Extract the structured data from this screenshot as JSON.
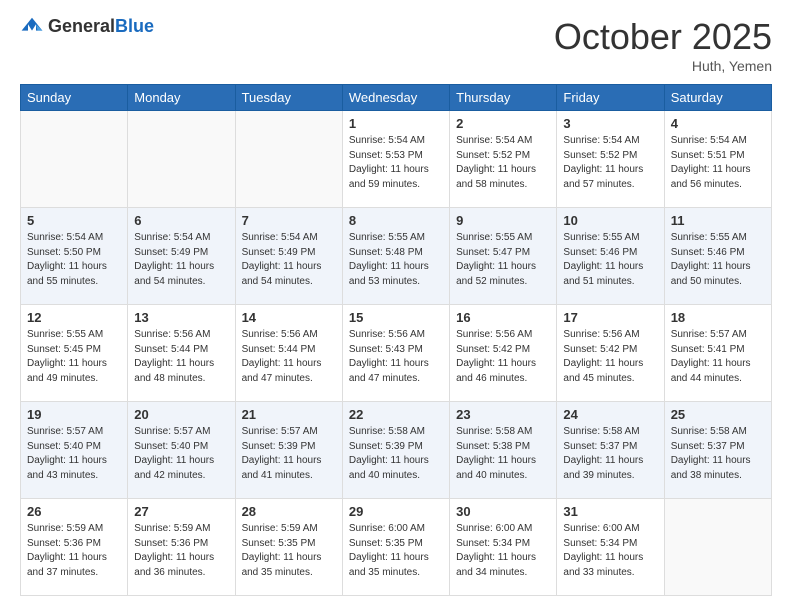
{
  "logo": {
    "text_general": "General",
    "text_blue": "Blue"
  },
  "header": {
    "month": "October 2025",
    "location": "Huth, Yemen"
  },
  "weekdays": [
    "Sunday",
    "Monday",
    "Tuesday",
    "Wednesday",
    "Thursday",
    "Friday",
    "Saturday"
  ],
  "weeks": [
    [
      {
        "day": "",
        "info": ""
      },
      {
        "day": "",
        "info": ""
      },
      {
        "day": "",
        "info": ""
      },
      {
        "day": "1",
        "info": "Sunrise: 5:54 AM\nSunset: 5:53 PM\nDaylight: 11 hours\nand 59 minutes."
      },
      {
        "day": "2",
        "info": "Sunrise: 5:54 AM\nSunset: 5:52 PM\nDaylight: 11 hours\nand 58 minutes."
      },
      {
        "day": "3",
        "info": "Sunrise: 5:54 AM\nSunset: 5:52 PM\nDaylight: 11 hours\nand 57 minutes."
      },
      {
        "day": "4",
        "info": "Sunrise: 5:54 AM\nSunset: 5:51 PM\nDaylight: 11 hours\nand 56 minutes."
      }
    ],
    [
      {
        "day": "5",
        "info": "Sunrise: 5:54 AM\nSunset: 5:50 PM\nDaylight: 11 hours\nand 55 minutes."
      },
      {
        "day": "6",
        "info": "Sunrise: 5:54 AM\nSunset: 5:49 PM\nDaylight: 11 hours\nand 54 minutes."
      },
      {
        "day": "7",
        "info": "Sunrise: 5:54 AM\nSunset: 5:49 PM\nDaylight: 11 hours\nand 54 minutes."
      },
      {
        "day": "8",
        "info": "Sunrise: 5:55 AM\nSunset: 5:48 PM\nDaylight: 11 hours\nand 53 minutes."
      },
      {
        "day": "9",
        "info": "Sunrise: 5:55 AM\nSunset: 5:47 PM\nDaylight: 11 hours\nand 52 minutes."
      },
      {
        "day": "10",
        "info": "Sunrise: 5:55 AM\nSunset: 5:46 PM\nDaylight: 11 hours\nand 51 minutes."
      },
      {
        "day": "11",
        "info": "Sunrise: 5:55 AM\nSunset: 5:46 PM\nDaylight: 11 hours\nand 50 minutes."
      }
    ],
    [
      {
        "day": "12",
        "info": "Sunrise: 5:55 AM\nSunset: 5:45 PM\nDaylight: 11 hours\nand 49 minutes."
      },
      {
        "day": "13",
        "info": "Sunrise: 5:56 AM\nSunset: 5:44 PM\nDaylight: 11 hours\nand 48 minutes."
      },
      {
        "day": "14",
        "info": "Sunrise: 5:56 AM\nSunset: 5:44 PM\nDaylight: 11 hours\nand 47 minutes."
      },
      {
        "day": "15",
        "info": "Sunrise: 5:56 AM\nSunset: 5:43 PM\nDaylight: 11 hours\nand 47 minutes."
      },
      {
        "day": "16",
        "info": "Sunrise: 5:56 AM\nSunset: 5:42 PM\nDaylight: 11 hours\nand 46 minutes."
      },
      {
        "day": "17",
        "info": "Sunrise: 5:56 AM\nSunset: 5:42 PM\nDaylight: 11 hours\nand 45 minutes."
      },
      {
        "day": "18",
        "info": "Sunrise: 5:57 AM\nSunset: 5:41 PM\nDaylight: 11 hours\nand 44 minutes."
      }
    ],
    [
      {
        "day": "19",
        "info": "Sunrise: 5:57 AM\nSunset: 5:40 PM\nDaylight: 11 hours\nand 43 minutes."
      },
      {
        "day": "20",
        "info": "Sunrise: 5:57 AM\nSunset: 5:40 PM\nDaylight: 11 hours\nand 42 minutes."
      },
      {
        "day": "21",
        "info": "Sunrise: 5:57 AM\nSunset: 5:39 PM\nDaylight: 11 hours\nand 41 minutes."
      },
      {
        "day": "22",
        "info": "Sunrise: 5:58 AM\nSunset: 5:39 PM\nDaylight: 11 hours\nand 40 minutes."
      },
      {
        "day": "23",
        "info": "Sunrise: 5:58 AM\nSunset: 5:38 PM\nDaylight: 11 hours\nand 40 minutes."
      },
      {
        "day": "24",
        "info": "Sunrise: 5:58 AM\nSunset: 5:37 PM\nDaylight: 11 hours\nand 39 minutes."
      },
      {
        "day": "25",
        "info": "Sunrise: 5:58 AM\nSunset: 5:37 PM\nDaylight: 11 hours\nand 38 minutes."
      }
    ],
    [
      {
        "day": "26",
        "info": "Sunrise: 5:59 AM\nSunset: 5:36 PM\nDaylight: 11 hours\nand 37 minutes."
      },
      {
        "day": "27",
        "info": "Sunrise: 5:59 AM\nSunset: 5:36 PM\nDaylight: 11 hours\nand 36 minutes."
      },
      {
        "day": "28",
        "info": "Sunrise: 5:59 AM\nSunset: 5:35 PM\nDaylight: 11 hours\nand 35 minutes."
      },
      {
        "day": "29",
        "info": "Sunrise: 6:00 AM\nSunset: 5:35 PM\nDaylight: 11 hours\nand 35 minutes."
      },
      {
        "day": "30",
        "info": "Sunrise: 6:00 AM\nSunset: 5:34 PM\nDaylight: 11 hours\nand 34 minutes."
      },
      {
        "day": "31",
        "info": "Sunrise: 6:00 AM\nSunset: 5:34 PM\nDaylight: 11 hours\nand 33 minutes."
      },
      {
        "day": "",
        "info": ""
      }
    ]
  ]
}
